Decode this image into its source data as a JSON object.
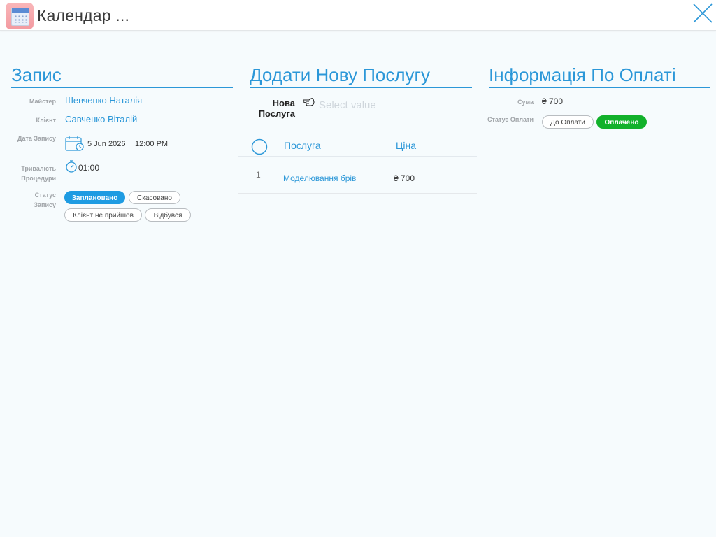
{
  "window": {
    "title": "Календар ...",
    "icon": "calendar-app-icon"
  },
  "appointment": {
    "heading": "Запис",
    "master_label": "Майстер",
    "master_value": "Шевченко Наталія",
    "client_label": "Клієнт",
    "client_value": "Савченко Віталій",
    "date_label": "Дата Запису",
    "date_value": "5 Jun 2026",
    "time_value": "12:00 PM",
    "duration_label_1": "Тривалість",
    "duration_label_2": "Процедури",
    "duration_value": "01:00",
    "status_label": "Статус Запису",
    "status_options": [
      "Заплановано",
      "Скасовано",
      "Клієнт не прийшов",
      "Відбувся"
    ],
    "status_selected": "Заплановано"
  },
  "services": {
    "heading": "Додати Нову Послугу",
    "new_service_label_1": "Нова",
    "new_service_label_2": "Послуга",
    "select_placeholder": "Select value",
    "columns": {
      "service": "Послуга",
      "price": "Ціна"
    },
    "rows": [
      {
        "index": "1",
        "name": "Моделювання брів",
        "price": "₴ 700"
      }
    ]
  },
  "payment": {
    "heading": "Інформація По Оплаті",
    "sum_label": "Сума",
    "sum_value": "₴ 700",
    "status_label": "Статус Оплати",
    "status_options": [
      "До Оплати",
      "Оплачено"
    ],
    "status_selected": "Оплачено"
  },
  "colors": {
    "accent": "#2b97d8",
    "status_blue": "#1e9be2",
    "status_green": "#12b12b",
    "background": "#f6fbfd"
  }
}
